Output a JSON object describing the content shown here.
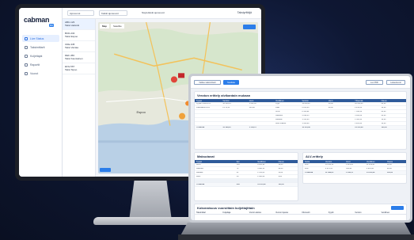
{
  "monitor_app": {
    "logo": "cabman",
    "logo_sub": "BO",
    "nav": [
      "Live Status",
      "Taksimittarit",
      "Kuljettajat",
      "Raportit",
      "Vuorot"
    ],
    "top": {
      "field1": "Ajoneuvot",
      "field2": "Kaikki ajoneuvot",
      "label": "Näytettävät ajoneuvot",
      "user": "Taksiyrittäjä"
    },
    "vehicles": [
      {
        "id": "ABC-123",
        "name": "Taksi Helsinki"
      },
      {
        "id": "BCD-234",
        "name": "Taksi Espoo"
      },
      {
        "id": "CDE-345",
        "name": "Taksi Vantaa"
      },
      {
        "id": "DEF-456",
        "name": "Taksi Kauniainen"
      },
      {
        "id": "EFG-567",
        "name": "Taksi Sipoo"
      }
    ],
    "map": {
      "tab_map": "Map",
      "tab_sat": "Satellite",
      "city1": "Espoo",
      "city2": "Helsinki"
    }
  },
  "laptop_app": {
    "header_left": "Valitse taksimittarit",
    "header_btn": "Suodata",
    "btn_export": "Luo PDF",
    "btn_print": "Lataa Excel",
    "card1": {
      "title": "Veroton erittely alvikantain mukaan",
      "cols": [
        "Tyyppi",
        "Veroton",
        "Verot",
        "Verollinen",
        "Veroton",
        "Verot",
        "Yhteensä",
        "Osuus"
      ],
      "rows": [
        [
          "Kyydin hinta 10%",
          "10 218,14",
          "1 021,81",
          "Kyyti",
          "11 239,95",
          "10,00",
          "10 013,40",
          "82,00"
        ],
        [
          "Lisämaksut 24%",
          "2 270,51",
          "544,92",
          "Lisät",
          "2 815,43",
          "24,00",
          "2 250,33",
          "18,00"
        ],
        [
          "",
          "",
          "",
          "Kortti",
          "8 106,92",
          "",
          "7 942,10",
          "64,00"
        ],
        [
          "",
          "",
          "",
          "Käteinen",
          "3 090,15",
          "",
          "3 029,16",
          "24,00"
        ],
        [
          "",
          "",
          "",
          "Laskulle",
          "1 551,63",
          "",
          "1 523,11",
          "12,00"
        ],
        [
          "",
          "",
          "",
          "Muut maksut",
          "1 306,68",
          "",
          "1 281,43",
          "10,00"
        ]
      ],
      "total": [
        "Yhteensä",
        "12 488,65",
        "1 566,73",
        "",
        "14 055,38",
        "",
        "14 055,38",
        "100,00"
      ]
    },
    "card2": {
      "title": "Maksutavat",
      "cols": [
        "Tyyppi",
        "Kpl",
        "Verollinen",
        "Osuus"
      ],
      "rows": [
        [
          "Kortti",
          "185",
          "8 106,92",
          "58,00"
        ],
        [
          "Käteinen",
          "72",
          "3 090,15",
          "22,00"
        ],
        [
          "Laskulle",
          "31",
          "1 551,63",
          "11,00"
        ],
        [
          "Muut",
          "18",
          "1 306,68",
          "9,00"
        ],
        [
          "",
          "",
          "",
          ""
        ]
      ],
      "total": [
        "Yhteensä",
        "306",
        "14 055,38",
        "100,00"
      ]
    },
    "card3": {
      "title": "ALV-erittely",
      "cols": [
        "Kanta",
        "Veroton",
        "Verot",
        "Verollinen",
        "Osuus"
      ],
      "rows": [
        [
          "10%",
          "10 218,14",
          "1 021,81",
          "11 239,95",
          "80,00"
        ],
        [
          "24%",
          "2 270,51",
          "544,92",
          "2 815,43",
          "20,00"
        ]
      ],
      "total": [
        "Yhteensä",
        "12 488,65",
        "1 566,73",
        "14 055,38",
        "100,00"
      ]
    },
    "card4": {
      "title": "Kokonaisuus vuoroittain kuljettajittain",
      "cols": [
        "Taksimittari",
        "Kuljettaja",
        "Vuoron aloitus",
        "Vuoron lopetus",
        "Kilometrit",
        "Kyydit",
        "Veroton",
        "Verollinen"
      ]
    }
  },
  "colors": {
    "accent": "#2b7de9",
    "header": "#2f5b9a",
    "background": "#0b1224"
  }
}
